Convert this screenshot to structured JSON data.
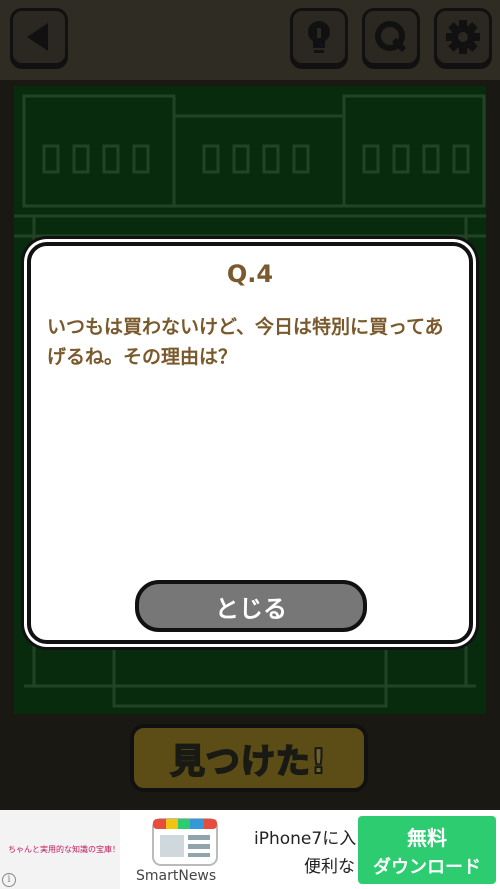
{
  "toolbar": {
    "back_icon": "back-triangle-icon",
    "hint_icon": "lightbulb-icon",
    "question_icon": "q-icon",
    "settings_icon": "gear-icon"
  },
  "dialog": {
    "title": "Q.4",
    "text": "いつもは買わないけど、今日は特別に買ってあげるね。その理由は？",
    "close_label": "とじる"
  },
  "found_button": {
    "label": "見つけた!"
  },
  "ad": {
    "left_text": "ちゃんと実用的な知識の宝庫！",
    "brand": "SmartNews",
    "line1": "iPhone7に入",
    "line2": "便利な",
    "cta_line1": "無料",
    "cta_line2": "ダウンロード",
    "info": "i"
  },
  "colors": {
    "scene_green": "#0f4f1a",
    "dialog_text": "#7a5a2c",
    "cta_green": "#2ecc71"
  }
}
